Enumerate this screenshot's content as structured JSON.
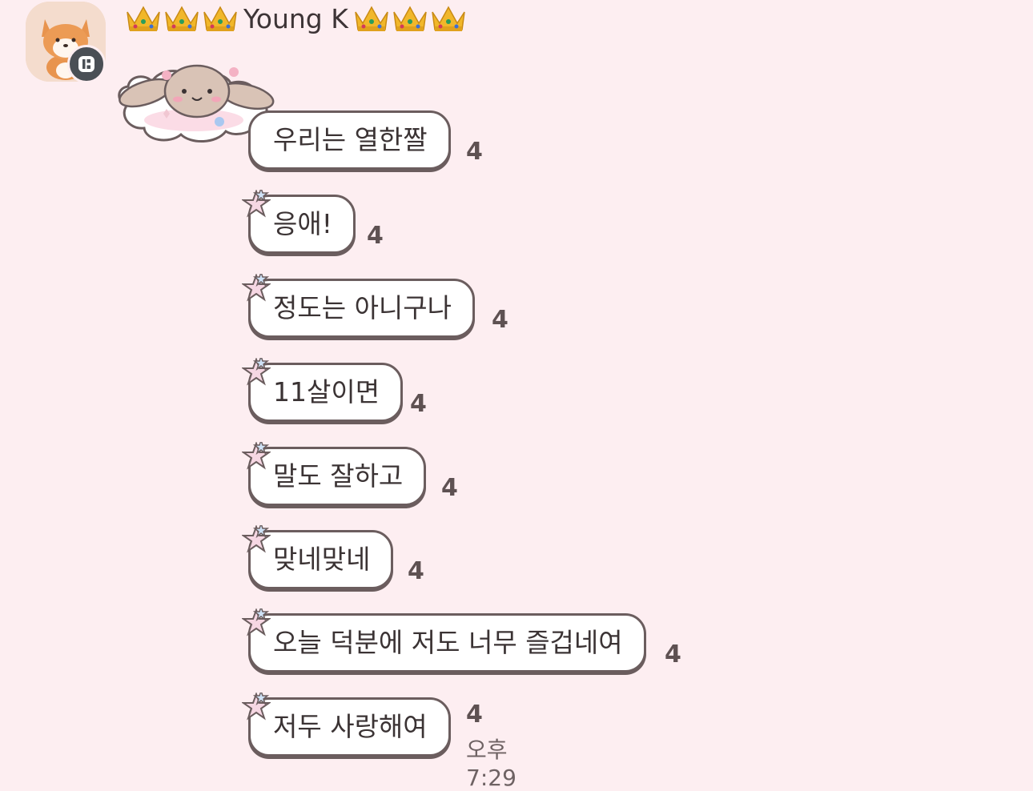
{
  "sender": {
    "name": "Young K",
    "crowns_before": 3,
    "crowns_after": 3
  },
  "messages": [
    {
      "text": "우리는 열한짤",
      "count": "4"
    },
    {
      "text": "응애!",
      "count": "4"
    },
    {
      "text": "정도는 아니구나",
      "count": "4"
    },
    {
      "text": "11살이면",
      "count": "4"
    },
    {
      "text": "말도 잘하고",
      "count": "4"
    },
    {
      "text": "맞네맞네",
      "count": "4"
    },
    {
      "text": "오늘 덕분에 저도 너무 즐겁네여",
      "count": "4"
    },
    {
      "text": "저두 사랑해여",
      "count": "4"
    }
  ],
  "timestamp": "오후 7:29",
  "colors": {
    "background": "#fdeef1",
    "bubble_border": "#6b5d5e",
    "text": "#3b3334"
  }
}
